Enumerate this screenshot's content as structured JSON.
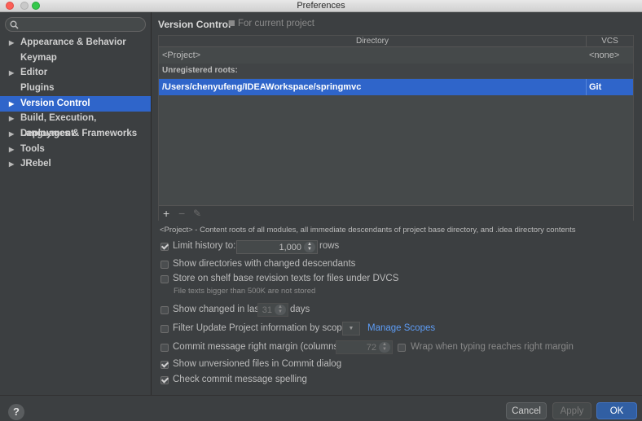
{
  "window": {
    "title": "Preferences"
  },
  "sidebar": {
    "search_placeholder": "",
    "items": [
      {
        "label": "Appearance & Behavior",
        "has_arrow": true
      },
      {
        "label": "Keymap",
        "has_arrow": false
      },
      {
        "label": "Editor",
        "has_arrow": true
      },
      {
        "label": "Plugins",
        "has_arrow": false
      },
      {
        "label": "Version Control",
        "has_arrow": true,
        "selected": true
      },
      {
        "label": "Build, Execution, Deployment",
        "has_arrow": true
      },
      {
        "label": "Languages & Frameworks",
        "has_arrow": true
      },
      {
        "label": "Tools",
        "has_arrow": true
      },
      {
        "label": "JRebel",
        "has_arrow": true
      }
    ]
  },
  "header": {
    "title": "Version Control",
    "subtitle": "For current project"
  },
  "table": {
    "columns": [
      "Directory",
      "VCS"
    ],
    "rows": [
      {
        "directory": "<Project>",
        "vcs": "<none>"
      },
      {
        "section": "Unregistered roots:"
      },
      {
        "directory": "/Users/chenyufeng/IDEAWorkspace/springmvc",
        "vcs": "Git",
        "selected": true
      }
    ],
    "toolbar": {
      "add": "+",
      "remove": "−",
      "edit": "✎"
    }
  },
  "note": "<Project> - Content roots of all modules, all immediate descendants of project base directory, and .idea directory contents",
  "options": {
    "limit_history": {
      "label": "Limit history to:",
      "checked": true,
      "value": "1,000",
      "suffix": "rows"
    },
    "show_dirs_changed": {
      "label": "Show directories with changed descendants",
      "checked": false
    },
    "store_on_shelf": {
      "label": "Store on shelf base revision texts for files under DVCS",
      "checked": false,
      "hint": "File texts bigger than 500K are not stored"
    },
    "show_changed_in_last": {
      "label": "Show changed in last",
      "checked": false,
      "value": "31",
      "suffix": "days"
    },
    "filter_update": {
      "label": "Filter Update Project information by scope",
      "checked": false,
      "link": "Manage Scopes"
    },
    "commit_margin": {
      "label": "Commit message right margin (columns):",
      "checked": false,
      "value": "72",
      "wrap_label": "Wrap when typing reaches right margin",
      "wrap_checked": false
    },
    "show_unversioned": {
      "label": "Show unversioned files in Commit dialog",
      "checked": true
    },
    "check_spelling": {
      "label": "Check commit message spelling",
      "checked": true
    }
  },
  "buttons": {
    "help": "?",
    "cancel": "Cancel",
    "apply": "Apply",
    "ok": "OK"
  },
  "colors": {
    "selection": "#2f65ca",
    "link": "#5d9cf5",
    "background": "#3c3f41"
  }
}
